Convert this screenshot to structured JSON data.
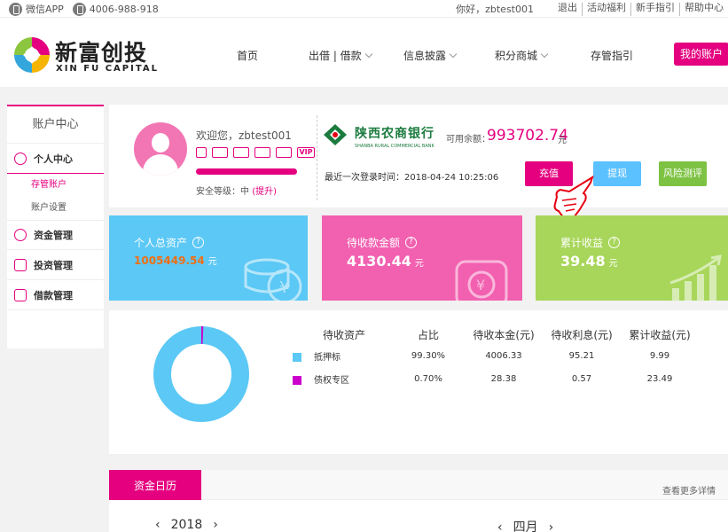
{
  "topbar": {
    "wechat_app": "微信APP",
    "hotline": "4006-988-918",
    "greeting": "你好，zbtest001",
    "links": [
      "退出",
      "活动福利",
      "新手指引",
      "帮助中心"
    ]
  },
  "brand": {
    "name_cn": "新富创投",
    "name_en": "XIN FU CAPITAL"
  },
  "nav": {
    "items": [
      {
        "label": "首页",
        "dropdown": false
      },
      {
        "label": "出借 | 借款",
        "dropdown": true
      },
      {
        "label": "信息披露",
        "dropdown": true
      },
      {
        "label": "积分商城",
        "dropdown": true
      },
      {
        "label": "存管指引",
        "dropdown": false
      }
    ],
    "my_account": "我的账户"
  },
  "sidebar": {
    "title": "账户中心",
    "personal_center": "个人中心",
    "sub_items": [
      "存管账户",
      "账户设置"
    ],
    "fund_mgmt": "资金管理",
    "invest_mgmt": "投资管理",
    "loan_mgmt": "借款管理"
  },
  "user": {
    "welcome": "欢迎您，zbtest001",
    "security_label": "安全等级：中",
    "upgrade": "(提升)",
    "vip": "VIP",
    "bank_name": "陕西农商银行",
    "bank_name_en": "SHANBA RURAL COMMERCIAL BANK",
    "balance_label": "可用余额：",
    "balance": "993702.74",
    "balance_unit": "元",
    "last_login": "最近一次登录时间：2018-04-24 10:25:06",
    "buttons": {
      "recharge": "充值",
      "withdraw": "提现",
      "risk": "风险测评"
    }
  },
  "stats": [
    {
      "label": "个人总资产",
      "value": "1005449.54",
      "unit": "元"
    },
    {
      "label": "待收款金额",
      "value": "4130.44",
      "unit": "元"
    },
    {
      "label": "累计收益",
      "value": "39.48",
      "unit": "元"
    }
  ],
  "distribution": {
    "headers": [
      "待收资产",
      "占比",
      "待收本金(元)",
      "待收利息(元)",
      "累计收益(元)"
    ],
    "rows": [
      {
        "name": "抵押标",
        "ratio": "99.30%",
        "principal": "4006.33",
        "interest": "95.21",
        "earnings": "9.99",
        "color": "#5bc8f5"
      },
      {
        "name": "债权专区",
        "ratio": "0.70%",
        "principal": "28.38",
        "interest": "0.57",
        "earnings": "23.49",
        "color": "#cc00cc"
      }
    ]
  },
  "calendar": {
    "title": "资金日历",
    "more": "查看更多详情",
    "year": "2018",
    "month": "四月"
  },
  "colors": {
    "brand_pink": "#e4007f",
    "blue": "#5bc8f5",
    "green": "#a8d65a",
    "pink_card": "#f260b0"
  }
}
